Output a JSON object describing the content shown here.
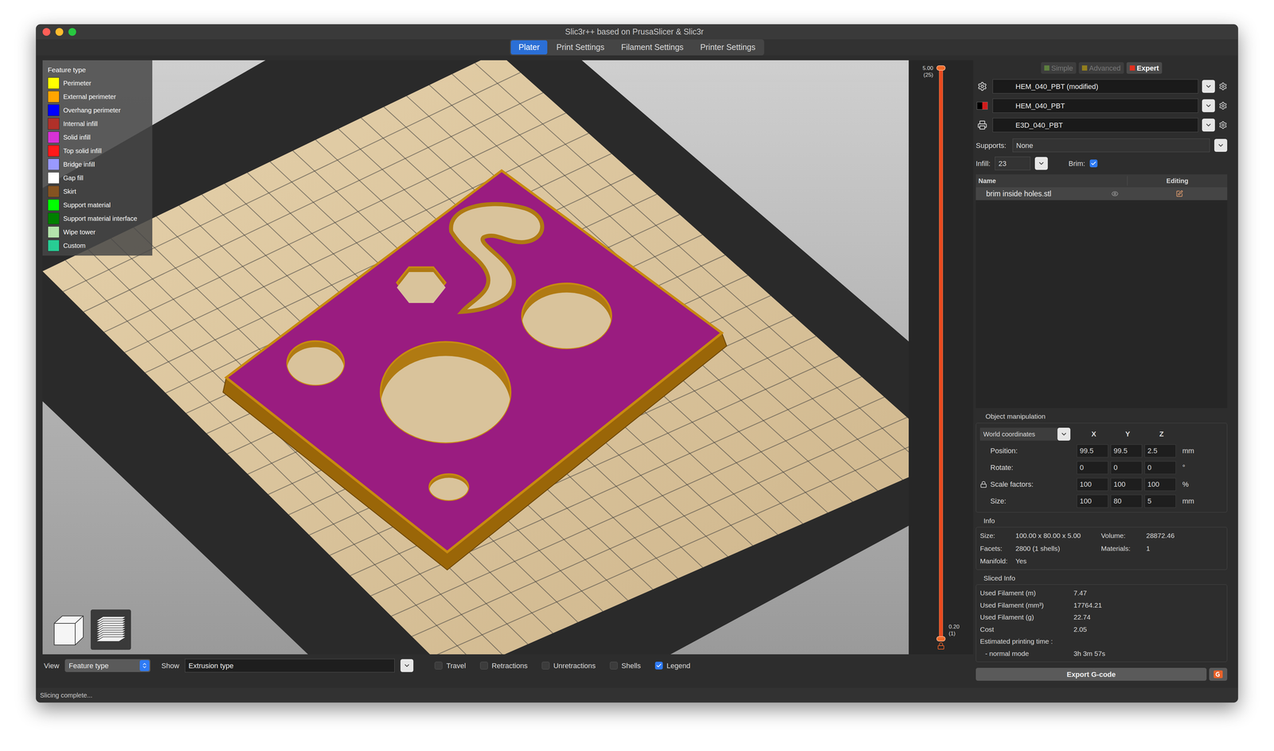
{
  "window": {
    "title": "Slic3r++ based on PrusaSlicer & Slic3r"
  },
  "tabs": [
    {
      "label": "Plater",
      "selected": true
    },
    {
      "label": "Print Settings",
      "selected": false
    },
    {
      "label": "Filament Settings",
      "selected": false
    },
    {
      "label": "Printer Settings",
      "selected": false
    }
  ],
  "legend": {
    "title": "Feature type",
    "items": [
      {
        "label": "Perimeter",
        "color": "#ffff00"
      },
      {
        "label": "External perimeter",
        "color": "#ffa500"
      },
      {
        "label": "Overhang perimeter",
        "color": "#0000ff"
      },
      {
        "label": "Internal infill",
        "color": "#b03029"
      },
      {
        "label": "Solid infill",
        "color": "#d732d7"
      },
      {
        "label": "Top solid infill",
        "color": "#ff1a1a"
      },
      {
        "label": "Bridge infill",
        "color": "#9999ff"
      },
      {
        "label": "Gap fill",
        "color": "#ffffff"
      },
      {
        "label": "Skirt",
        "color": "#845321"
      },
      {
        "label": "Support material",
        "color": "#00ff00"
      },
      {
        "label": "Support material interface",
        "color": "#008000"
      },
      {
        "label": "Wipe tower",
        "color": "#b3e3ab"
      },
      {
        "label": "Custom",
        "color": "#28cc94"
      }
    ]
  },
  "layer_slider": {
    "top_label": "5.00",
    "top_sub": "(25)",
    "bottom_label": "0.20",
    "bottom_sub": "(1)",
    "upper_level": 1,
    "lower_level": 0
  },
  "preview_bar": {
    "view_label": "View",
    "view_value": "Feature type",
    "show_label": "Show",
    "show_value": "Extrusion type",
    "options": [
      {
        "label": "Travel",
        "checked": false
      },
      {
        "label": "Retractions",
        "checked": false
      },
      {
        "label": "Unretractions",
        "checked": false
      },
      {
        "label": "Shells",
        "checked": false
      },
      {
        "label": "Legend",
        "checked": true
      }
    ]
  },
  "view_buttons": [
    {
      "kind": "3d",
      "selected": false
    },
    {
      "kind": "preview",
      "selected": true
    }
  ],
  "modes": [
    {
      "label": "Simple",
      "selected": false,
      "color": "#7dc242"
    },
    {
      "label": "Advanced",
      "selected": false,
      "color": "#e8c000"
    },
    {
      "label": "Expert",
      "selected": true,
      "color": "#e0301e"
    }
  ],
  "presets": [
    {
      "kind": "print",
      "value": "HEM_040_PBT (modified)"
    },
    {
      "kind": "filament",
      "value": "HEM_040_PBT"
    },
    {
      "kind": "printer",
      "value": "E3D_040_PBT"
    }
  ],
  "supports": {
    "label": "Supports:",
    "value": "None"
  },
  "infill": {
    "label": "Infill:",
    "value": "23"
  },
  "brim": {
    "label": "Brim:",
    "checked": true
  },
  "object_list": {
    "columns": [
      "Name",
      "Editing"
    ],
    "rows": [
      {
        "name": "brim inside holes.stl",
        "selected": true
      }
    ]
  },
  "object_manipulation": {
    "title": "Object manipulation",
    "coordinates": "World coordinates",
    "axes": [
      "X",
      "Y",
      "Z"
    ],
    "rows": [
      {
        "label": "Position:",
        "values": [
          "99.5",
          "99.5",
          "2.5"
        ],
        "unit": "mm"
      },
      {
        "label": "Rotate:",
        "values": [
          "0",
          "0",
          "0"
        ],
        "unit": "°"
      },
      {
        "label": "Scale factors:",
        "values": [
          "100",
          "100",
          "100"
        ],
        "unit": "%",
        "locked": true
      },
      {
        "label": "Size:",
        "values": [
          "100",
          "80",
          "5"
        ],
        "unit": "mm"
      }
    ]
  },
  "info": {
    "title": "Info",
    "items": [
      {
        "label": "Size:",
        "value": "100.00 x 80.00 x 5.00"
      },
      {
        "label": "Volume:",
        "value": "28872.46"
      },
      {
        "label": "Facets:",
        "value": "2800 (1 shells)"
      },
      {
        "label": "Materials:",
        "value": "1"
      },
      {
        "label": "Manifold:",
        "value": "Yes"
      }
    ]
  },
  "sliced_info": {
    "title": "Sliced Info",
    "items": [
      {
        "label": "Used Filament (m)",
        "value": "7.47"
      },
      {
        "label": "Used Filament (mm³)",
        "value": "17764.21"
      },
      {
        "label": "Used Filament (g)",
        "value": "22.74"
      },
      {
        "label": "Cost",
        "value": "2.05"
      }
    ],
    "time": {
      "label": "Estimated printing time :",
      "mode": "- normal mode",
      "value": "3h 3m 57s"
    }
  },
  "export": {
    "label": "Export G-code"
  },
  "status_bar": "Slicing complete..."
}
